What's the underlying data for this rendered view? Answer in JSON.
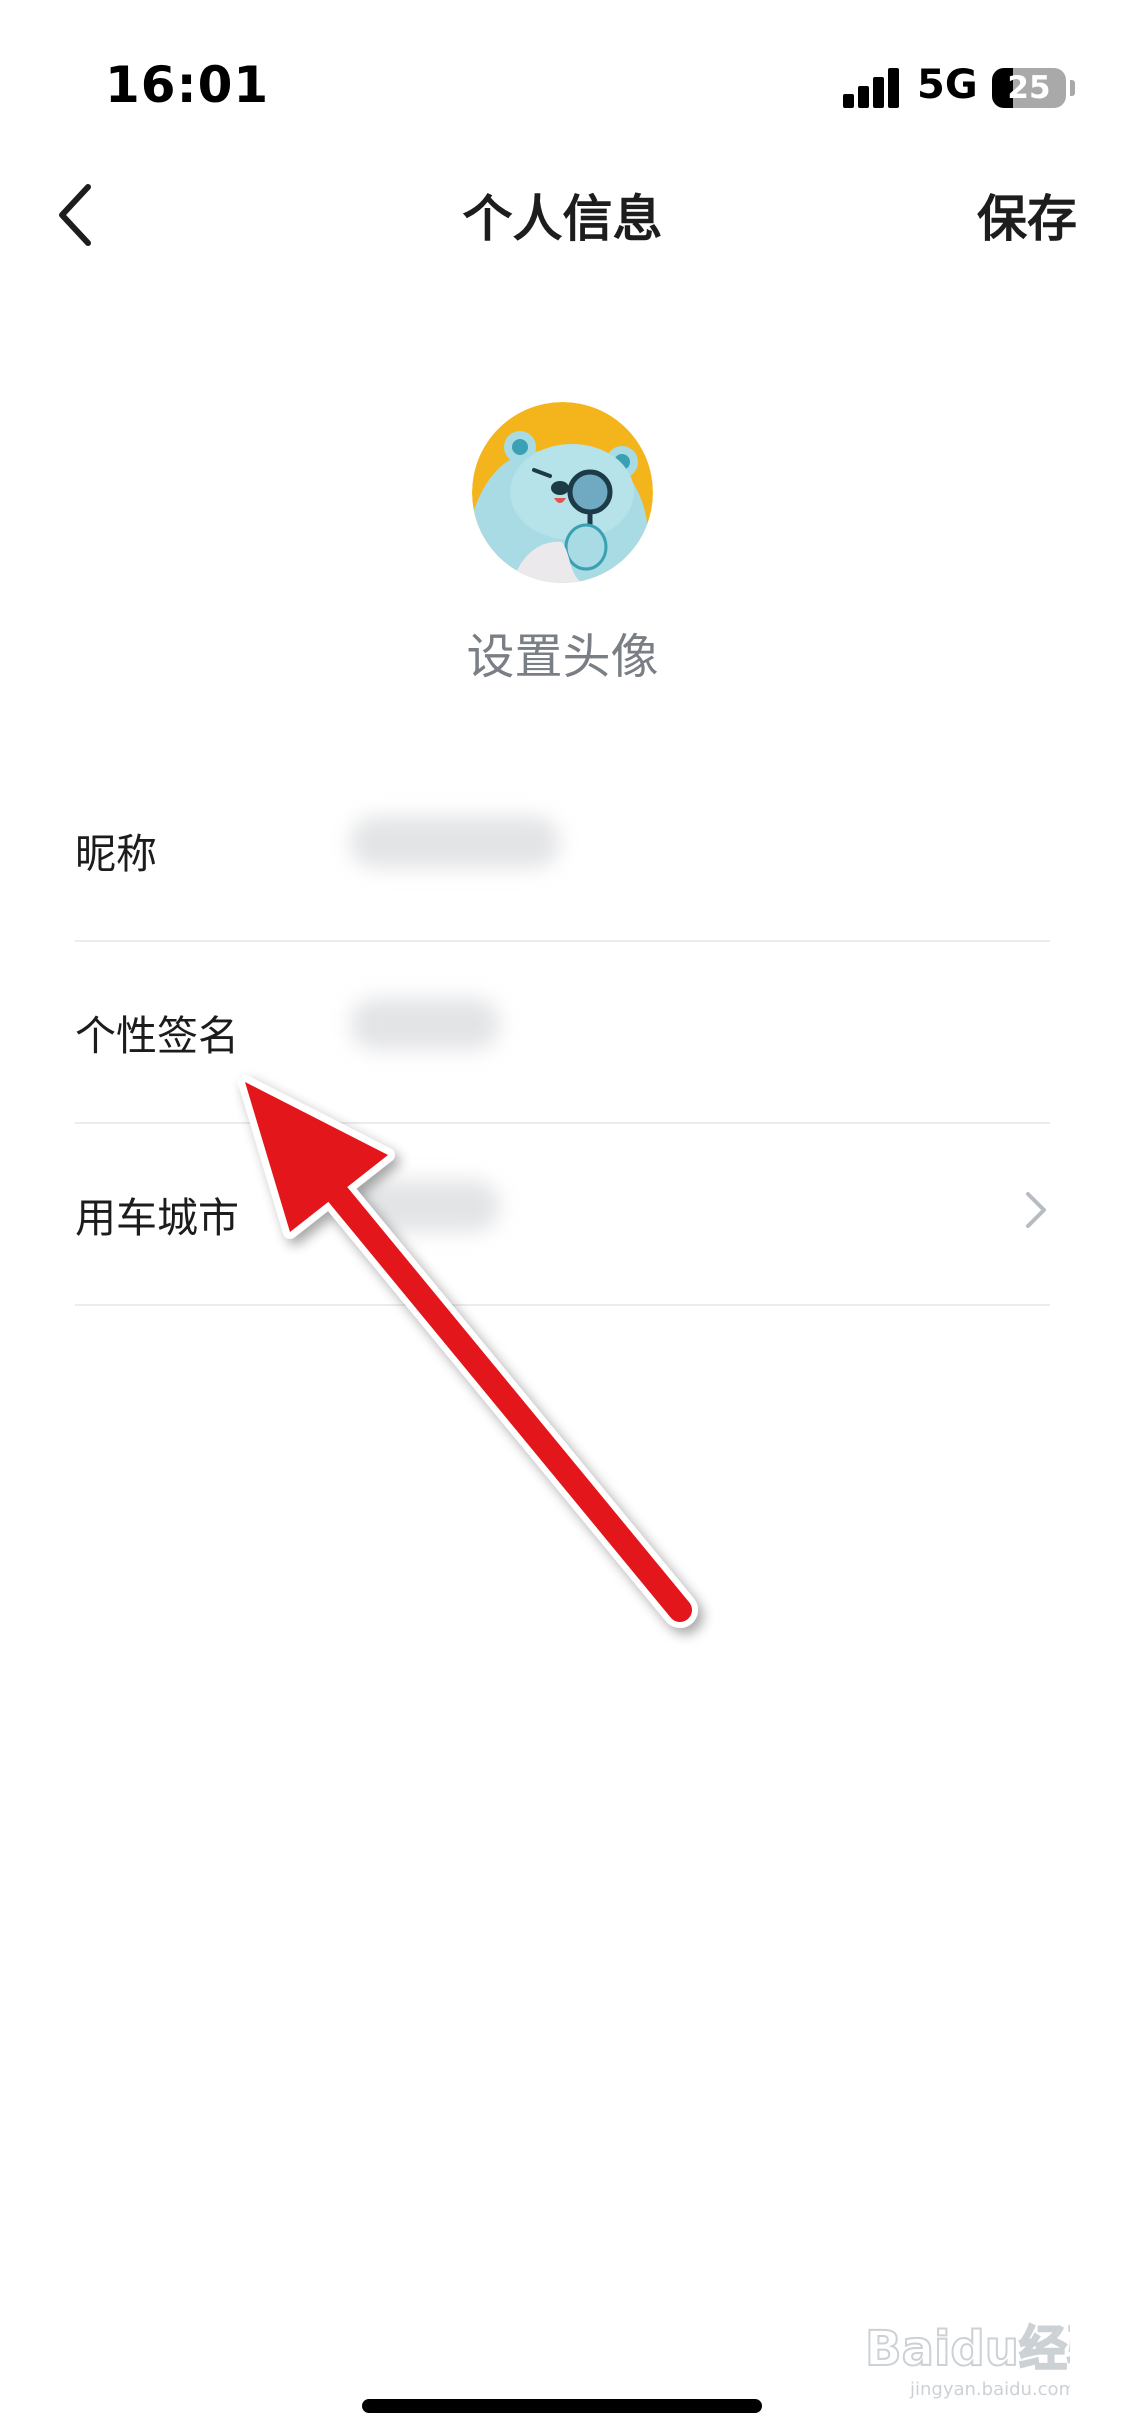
{
  "status_bar": {
    "time": "16:01",
    "network": "5G",
    "battery": "25"
  },
  "header": {
    "title": "个人信息",
    "save_label": "保存",
    "back_icon": "chevron-left-icon"
  },
  "avatar": {
    "label": "设置头像"
  },
  "fields": [
    {
      "label": "昵称",
      "has_chevron": false
    },
    {
      "label": "个性签名",
      "has_chevron": false
    },
    {
      "label": "用车城市",
      "has_chevron": true
    }
  ],
  "colors": {
    "avatar_background": "#f4b51c",
    "annotation_arrow": "#e3131b",
    "muted_text": "#7a7f85",
    "divider": "#ececec"
  },
  "watermark": {
    "brand": "Baidu经验",
    "url": "jingyan.baidu.com"
  }
}
